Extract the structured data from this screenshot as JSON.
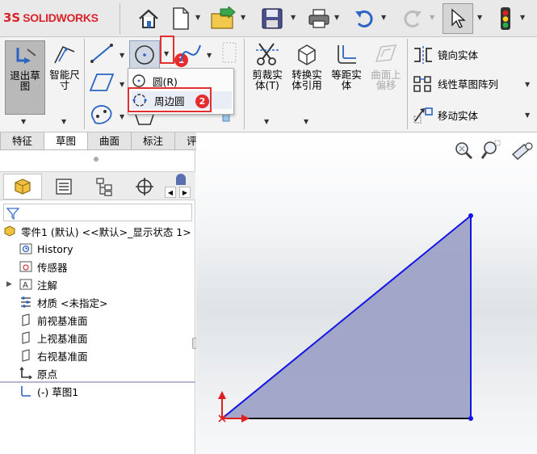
{
  "app": {
    "brand": "SOLIDWORKS"
  },
  "colors": {
    "brand_red": "#d8232a",
    "annotation_red": "#e03030",
    "sketch_blue": "#1414e6",
    "face_fill": "#9a9ec4"
  },
  "ribbon": {
    "exit_sketch": "退出草图",
    "smart_dim": "智能尺寸",
    "trim": "剪裁实体(T)",
    "convert": "转换实体引用",
    "offset": "等距实体",
    "offset_surface": "曲面上偏移",
    "mirror": "镜向实体",
    "linear_pattern": "线性草图阵列",
    "move": "移动实体"
  },
  "popup": {
    "circle": "圆(R)",
    "perimeter_circle": "周边圆",
    "badge1": "1",
    "badge2": "2"
  },
  "tabs": [
    "特征",
    "草图",
    "曲面",
    "标注",
    "评估"
  ],
  "tree": {
    "part": "零件1 (默认) <<默认>_显示状态 1>",
    "items": [
      "History",
      "传感器",
      "注解",
      "材质 <未指定>",
      "前视基准面",
      "上视基准面",
      "右视基准面",
      "原点",
      "(-) 草图1"
    ]
  }
}
